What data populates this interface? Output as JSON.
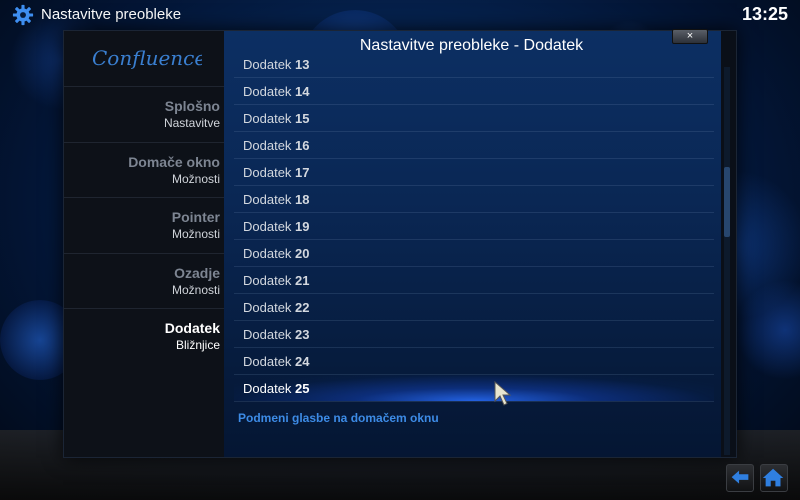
{
  "app": {
    "window_title": "Nastavitve preobleke",
    "clock": "13:25"
  },
  "dialog": {
    "title": "Nastavitve preobleke - Dodatek",
    "close_label": "×",
    "logo_text": "Confluence"
  },
  "sidebar": {
    "items": [
      {
        "main": "Splošno",
        "sub": "Nastavitve",
        "active": false
      },
      {
        "main": "Domače okno",
        "sub": "Možnosti",
        "active": false
      },
      {
        "main": "Pointer",
        "sub": "Možnosti",
        "active": false
      },
      {
        "main": "Ozadje",
        "sub": "Možnosti",
        "active": false
      },
      {
        "main": "Dodatek",
        "sub": "Bližnjice",
        "active": true
      }
    ]
  },
  "list": {
    "prefix": "Dodatek",
    "items": [
      "13",
      "14",
      "15",
      "16",
      "17",
      "18",
      "19",
      "20",
      "21",
      "22",
      "23",
      "24",
      "25"
    ],
    "selected": "25",
    "extra_option": "Podmeni glasbe na domačem oknu"
  },
  "icons": {
    "settings": "gear-icon",
    "back": "back-arrow-icon",
    "home": "home-icon",
    "pointer": "mouse-pointer-icon"
  },
  "colors": {
    "accent": "#3d8be6",
    "selected_glow": "#2a6cff"
  }
}
